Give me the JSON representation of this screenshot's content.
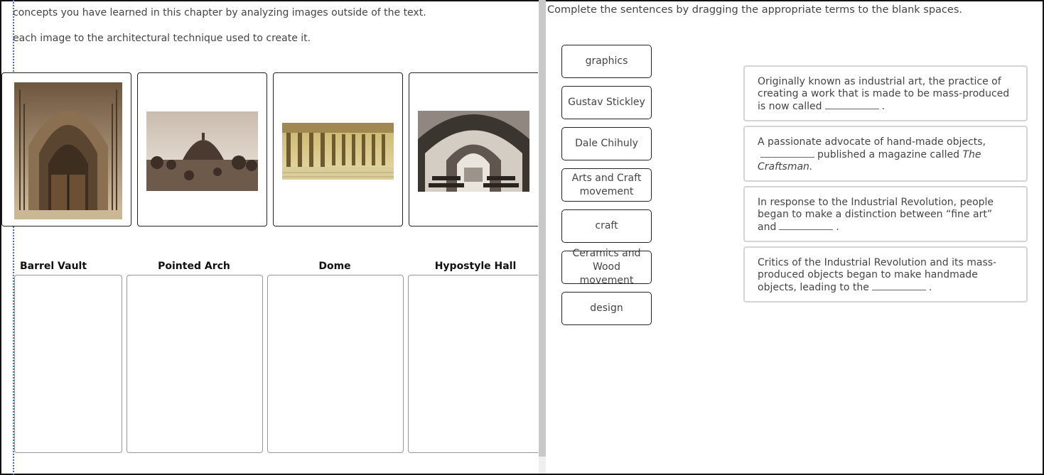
{
  "left_panel": {
    "instruction_line1": "concepts you have learned in this chapter by analyzing images outside of the text.",
    "instruction_line2": "each image to the architectural technique used to create it.",
    "images": [
      {
        "icon": "pointed-arch-photo"
      },
      {
        "icon": "dome-photo"
      },
      {
        "icon": "hypostyle-hall-photo"
      },
      {
        "icon": "barrel-vault-photo"
      }
    ],
    "categories": [
      "Barrel Vault",
      "Pointed Arch",
      "Dome",
      "Hypostyle Hall"
    ]
  },
  "right_panel": {
    "instruction": "Complete the sentences by dragging the appropriate terms to the blank spaces.",
    "terms": [
      "graphics",
      "Gustav Stickley",
      "Dale Chihuly",
      "Arts and Craft movement",
      "craft",
      "Ceramics and Wood movement",
      "design"
    ],
    "sentences": [
      {
        "before": "Originally known as industrial art, the practice of creating a work that is made to be mass-produced is now called",
        "after": "."
      },
      {
        "before": "A passionate advocate of hand-made objects,",
        "middle": "published a magazine called",
        "title": "The Craftsman.",
        "after": ""
      },
      {
        "before": "In response to the Industrial Revolution, people began to make a distinction between  “fine art” and",
        "after": "."
      },
      {
        "before": "Critics of the Industrial Revolution and its mass-produced objects began to make handmade objects, leading to the",
        "after": "."
      }
    ]
  }
}
